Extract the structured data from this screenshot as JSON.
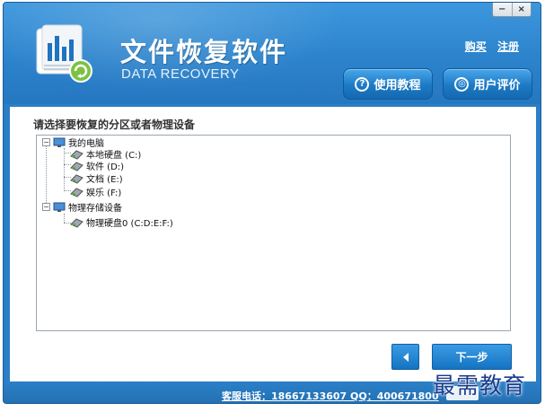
{
  "window": {
    "minimize_label": "−",
    "close_label": "×"
  },
  "header": {
    "title": "文件恢复软件",
    "subtitle": "DATA RECOVERY",
    "links": {
      "buy": "购买",
      "register": "注册"
    },
    "buttons": {
      "tutorial": "使用教程",
      "review": "用户评价"
    }
  },
  "main": {
    "prompt": "请选择要恢复的分区或者物理设备",
    "tree": {
      "computer": {
        "label": "我的电脑",
        "children": [
          {
            "label": "本地硬盘 (C:)"
          },
          {
            "label": "软件 (D:)"
          },
          {
            "label": "文档 (E:)"
          },
          {
            "label": "娱乐 (F:)"
          }
        ]
      },
      "physical": {
        "label": "物理存储设备",
        "children": [
          {
            "label": "物理硬盘0 (C:D:E:F:)"
          }
        ]
      }
    },
    "next_label": "下一步"
  },
  "footer": {
    "support": "客服电话：18667133607 QQ：400671800"
  },
  "watermark": "最需教育",
  "colors": {
    "header_blue": "#2c83cc",
    "button_blue": "#1c7ac5",
    "border_blue": "#1a5d98"
  }
}
